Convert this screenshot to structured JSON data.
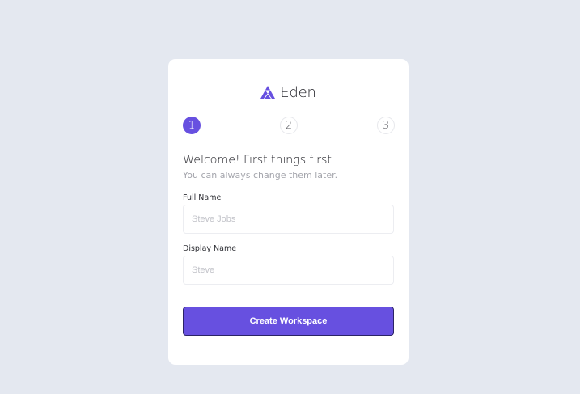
{
  "brand": {
    "name": "Eden",
    "logo_icon": "triangle-logo-icon",
    "accent_color": "#6750e0"
  },
  "stepper": {
    "steps": [
      "1",
      "2",
      "3"
    ],
    "active_step": 1
  },
  "form": {
    "heading": "Welcome! First things first...",
    "subheading": "You can always change them later.",
    "full_name": {
      "label": "Full Name",
      "placeholder": "Steve Jobs",
      "value": ""
    },
    "display_name": {
      "label": "Display Name",
      "placeholder": "Steve",
      "value": ""
    },
    "submit_label": "Create Workspace"
  }
}
